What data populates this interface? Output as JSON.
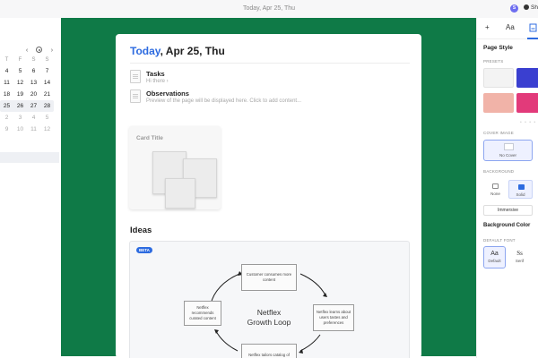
{
  "topbar": {
    "title": "Today, Apr 25, Thu",
    "avatar_initial": "S",
    "share_label": "Sh"
  },
  "calendar": {
    "nav": {
      "prev": "‹",
      "next": "›"
    },
    "weekdays": [
      "T",
      "F",
      "S",
      "S"
    ],
    "weeks": [
      [
        "4",
        "5",
        "6",
        "7"
      ],
      [
        "11",
        "12",
        "13",
        "14"
      ],
      [
        "18",
        "19",
        "20",
        "21"
      ],
      [
        "25",
        "26",
        "27",
        "28"
      ],
      [
        "2",
        "3",
        "4",
        "5"
      ],
      [
        "9",
        "10",
        "11",
        "12"
      ]
    ],
    "selected_week": 3
  },
  "page": {
    "title_today": "Today",
    "title_rest": ", Apr 25, Thu",
    "subpages": [
      {
        "name": "Tasks",
        "desc": "Hi there ›"
      },
      {
        "name": "Observations",
        "desc": "Preview of the page will be displayed here. Click to add content..."
      }
    ],
    "card_title": "Card Title",
    "ideas_heading": "Ideas",
    "beta_badge": "BETA",
    "loop": {
      "center": "Netflex\nGrowth Loop",
      "top": "Customer consumes more content",
      "right": "Netflex learns about users tastes and preferences",
      "left": "Netflex recommends curated content",
      "bottom": "Netflex tailors catalog of"
    }
  },
  "right_panel": {
    "tabs": [
      "+",
      "Aa"
    ],
    "active_tab_icon": "document-icon",
    "page_style": "Page Style",
    "presets_label": "PRESETS",
    "cover_image_label": "COVER IMAGE",
    "no_cover": "No Cover",
    "background_label": "BACKGROUND",
    "bg_options": [
      "None",
      "Solid",
      "G"
    ],
    "immersive": "Immersive",
    "background_color": "Background Color",
    "default_font_label": "DEFAULT FONT",
    "fonts": [
      {
        "sample": "Aa",
        "label": "Default"
      },
      {
        "sample": "Ss",
        "label": "Serif"
      }
    ]
  },
  "colors": {
    "stage": "#0f7a47",
    "accent": "#2d6be0",
    "preset_blue": "#3a3fd0",
    "preset_pink": "#e23a7a",
    "preset_peach": "#f1b3a8"
  }
}
